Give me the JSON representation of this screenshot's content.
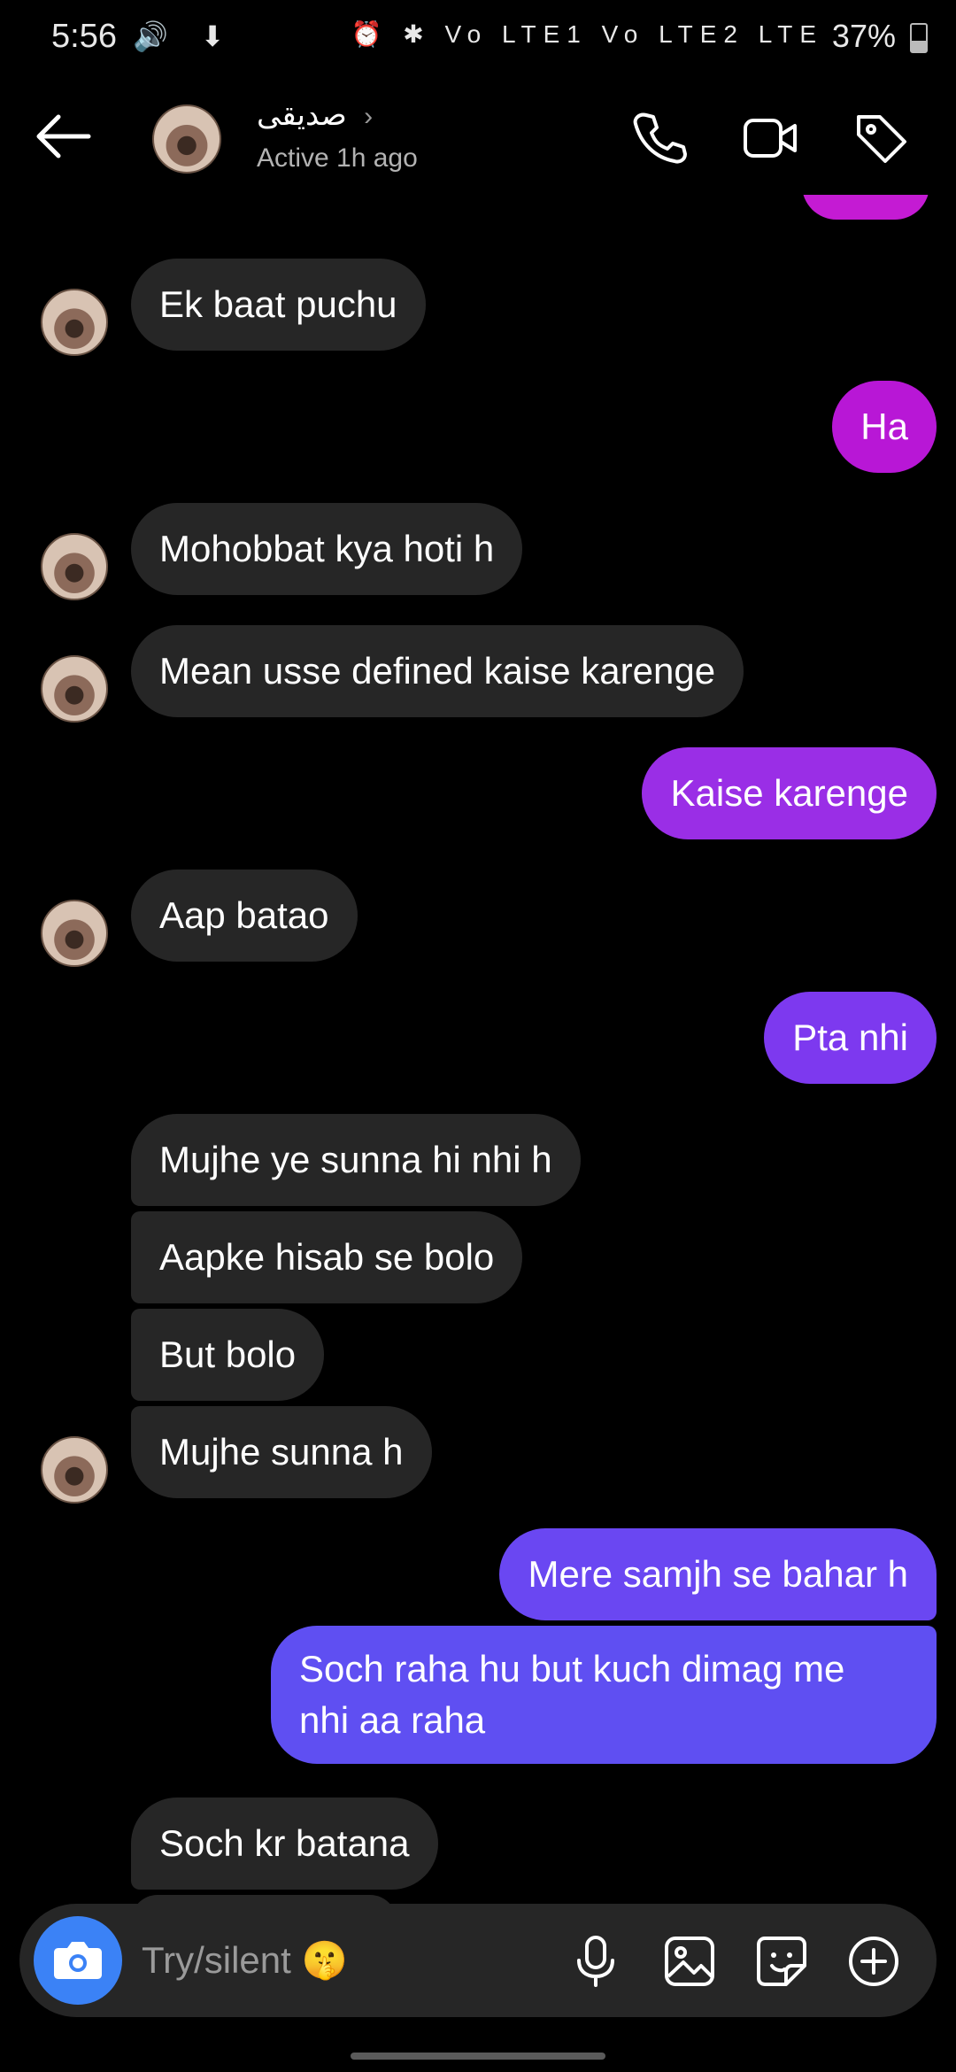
{
  "status_bar": {
    "time": "5:56",
    "left_icons": "🔊 ⬇",
    "right_icons": "⏰ ✱ Vo LTE1 Vo LTE2 LTE",
    "battery": "37%"
  },
  "header": {
    "contact_name": "صديقى",
    "chevron": "›",
    "status": "Active 1h ago",
    "icons": [
      "back-arrow-icon",
      "phone-icon",
      "video-icon",
      "tag-icon"
    ]
  },
  "messages": [
    {
      "side": "in",
      "text": "Ek baat puchu",
      "avatar": true
    },
    {
      "side": "out",
      "text": "Ha",
      "color": "#b817d6"
    },
    {
      "side": "in",
      "text": "Mohobbat kya hoti h",
      "avatar": true
    },
    {
      "side": "in",
      "text": "Mean usse defined kaise karenge",
      "avatar": true
    },
    {
      "side": "out",
      "text": "Kaise karenge",
      "color": "#9a2ee6"
    },
    {
      "side": "in",
      "text": "Aap batao",
      "avatar": true
    },
    {
      "side": "out",
      "text": "Pta nhi",
      "color": "#7d39ef"
    },
    {
      "side": "in",
      "text": "Mujhe ye sunna hi nhi h",
      "avatar": false
    },
    {
      "side": "in",
      "text": "Aapke hisab se bolo",
      "avatar": false
    },
    {
      "side": "in",
      "text": "But bolo",
      "avatar": false
    },
    {
      "side": "in",
      "text": "Mujhe sunna h",
      "avatar": true
    },
    {
      "side": "out",
      "text": "Mere samjh se bahar h",
      "color": "#6a47f2"
    },
    {
      "side": "out",
      "text": "Soch raha hu but kuch dimag me",
      "text2": "nhi aa raha",
      "color": "#5f4ff2"
    },
    {
      "side": "in",
      "text": "Soch kr batana",
      "avatar": false
    }
  ],
  "composer": {
    "placeholder": "Try/silent 🤫",
    "icons": [
      "camera-icon",
      "microphone-icon",
      "gallery-icon",
      "sticker-icon",
      "add-icon"
    ],
    "accent": "#3b82f6"
  }
}
